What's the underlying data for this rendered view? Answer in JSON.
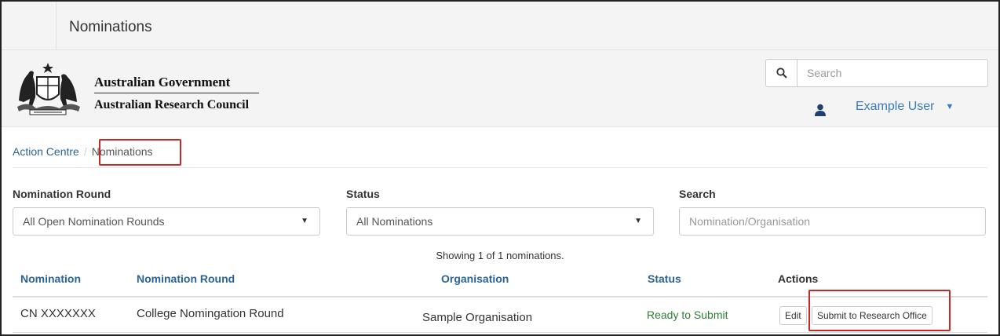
{
  "topbar": {
    "title": "Nominations"
  },
  "header": {
    "government_name": "Australian Government",
    "council_name": "Australian Research Council",
    "search": {
      "placeholder": "Search",
      "value": ""
    },
    "user": {
      "name": "Example User"
    }
  },
  "breadcrumb": {
    "items": [
      {
        "label": "Action Centre"
      },
      {
        "label": "Nominations"
      }
    ],
    "separator": "/"
  },
  "filters": {
    "nomination_round": {
      "label": "Nomination Round",
      "selected": "All Open Nomination Rounds"
    },
    "status": {
      "label": "Status",
      "selected": "All Nominations"
    },
    "search": {
      "label": "Search",
      "placeholder": "Nomination/Organisation",
      "value": ""
    }
  },
  "results": {
    "summary": "Showing 1 of 1 nominations."
  },
  "table": {
    "columns": [
      "Nomination",
      "Nomination Round",
      "Organisation",
      "Status",
      "Actions"
    ],
    "rows": [
      {
        "nomination": "CN XXXXXXX",
        "round": "College Nomingation Round",
        "organisation": "Sample Organisation",
        "status": "Ready to Submit",
        "actions": [
          "Edit",
          "Submit to Research Office"
        ]
      }
    ]
  },
  "colors": {
    "link": "#2a6496",
    "status_ready": "#2e7d32",
    "highlight": "#c62828",
    "header_bg": "#f4f4f4"
  },
  "icons": {
    "crest": "australian-coat-of-arms",
    "search": "magnifier-icon",
    "user": "user-silhouette-icon",
    "dropdown": "caret-down-icon"
  }
}
